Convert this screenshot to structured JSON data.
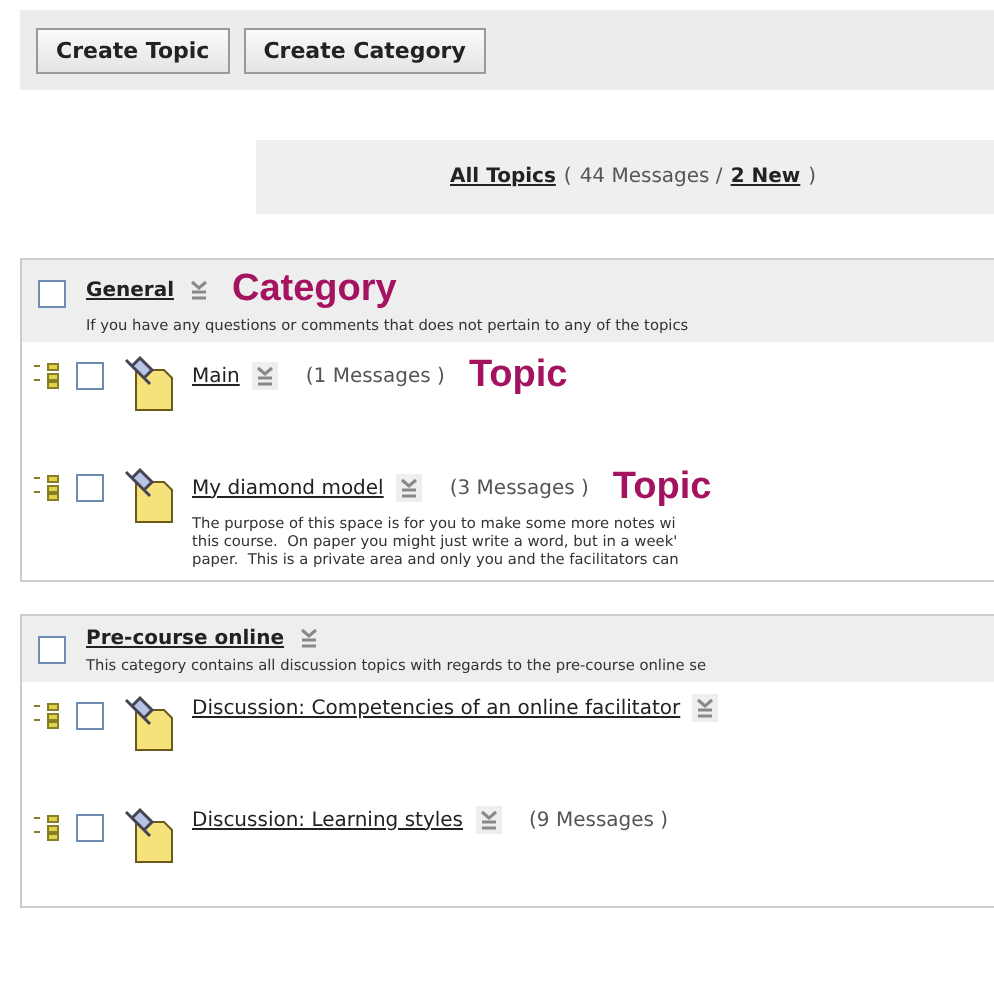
{
  "toolbar": {
    "buttons": [
      "Create Topic",
      "Create Category"
    ]
  },
  "summary": {
    "link": "All Topics",
    "open": "(",
    "messages": "44 Messages /",
    "new_link": "2 New",
    "close": ")"
  },
  "categories": [
    {
      "title": "General",
      "checked": false,
      "annotation": "Category",
      "description": "If you have any questions or comments that does not pertain to any of the topics",
      "topics": [
        {
          "title": "Main",
          "checked": false,
          "count": "(1 Messages )",
          "annotation": "Topic"
        },
        {
          "title": "My diamond model",
          "checked": false,
          "count": "(3 Messages )",
          "annotation": "Topic",
          "description": [
            "The purpose of this space is for you to make some more notes wi",
            "this course.  On paper you might just write a word, but in a week'",
            "paper.  This is a private area and only you and the facilitators can"
          ]
        }
      ]
    },
    {
      "title": "Pre-course online",
      "checked": false,
      "description": "This category contains all discussion topics with regards to the pre-course online se",
      "topics": [
        {
          "title": "Discussion: Competencies of an online facilitator",
          "checked": false
        },
        {
          "title": "Discussion: Learning styles",
          "checked": false,
          "count": "(9 Messages )"
        }
      ]
    }
  ]
}
